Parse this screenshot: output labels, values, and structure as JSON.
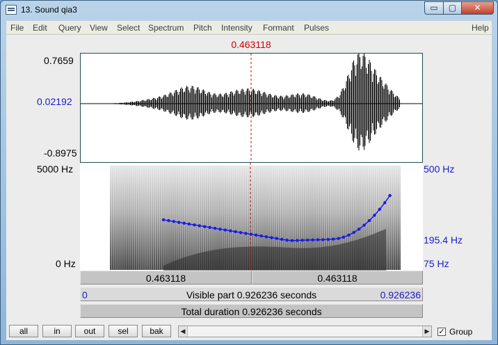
{
  "window": {
    "title": "13. Sound qia3",
    "min_label": "▭",
    "max_label": "▢",
    "close_label": "✕"
  },
  "menu": [
    "File",
    "Edit",
    "Query",
    "View",
    "Select",
    "Spectrum",
    "Pitch",
    "Intensity",
    "Formant",
    "Pulses",
    "Help"
  ],
  "cursor": {
    "time_top": "0.463118",
    "time_fraction": 0.5
  },
  "waveform": {
    "ymax": "0.7659",
    "ycursor": "0.02192",
    "ymin": "-0.8975"
  },
  "spectrogram": {
    "fmax": "5000 Hz",
    "fmin": "0 Hz",
    "pitch_top": "500 Hz",
    "pitch_value": "195.4 Hz",
    "pitch_bottom": "75 Hz"
  },
  "bars": {
    "left_time": "0.463118",
    "right_time": "0.463118",
    "visible_start": "0",
    "visible_text": "Visible part 0.926236 seconds",
    "visible_end": "0.926236",
    "total_text": "Total duration 0.926236 seconds"
  },
  "buttons": {
    "all": "all",
    "in": "in",
    "out": "out",
    "sel": "sel",
    "bak": "bak"
  },
  "group": {
    "label": "Group",
    "checked": true,
    "check_glyph": "✓"
  },
  "scroll": {
    "left": "◀",
    "right": "▶"
  }
}
